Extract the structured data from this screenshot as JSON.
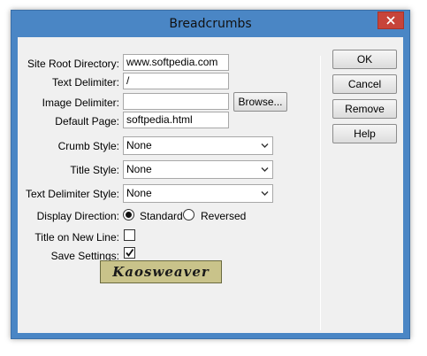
{
  "window": {
    "title": "Breadcrumbs"
  },
  "form": {
    "site_root_label": "Site Root Directory:",
    "site_root_value": "www.softpedia.com",
    "text_delim_label": "Text Delimiter:",
    "text_delim_value": "/",
    "image_delim_label": "Image Delimiter:",
    "image_delim_value": "",
    "browse_label": "Browse...",
    "default_page_label": "Default Page:",
    "default_page_value": "softpedia.html",
    "crumb_style_label": "Crumb Style:",
    "crumb_style_value": "None",
    "title_style_label": "Title Style:",
    "title_style_value": "None",
    "text_delim_style_label": "Text Delimiter Style:",
    "text_delim_style_value": "None",
    "display_direction_label": "Display Direction:",
    "direction_standard": "Standard",
    "direction_reversed": "Reversed",
    "title_new_line_label": "Title on New Line:",
    "save_settings_label": "Save Settings:"
  },
  "buttons": {
    "ok": "OK",
    "cancel": "Cancel",
    "remove": "Remove",
    "help": "Help"
  },
  "state": {
    "direction_selected": "Standard",
    "title_on_new_line": false,
    "save_settings": true
  },
  "logo": {
    "text": "Kaosweaver"
  },
  "colors": {
    "frame": "#4a86c5",
    "close": "#c7443a",
    "client": "#f0f0f0"
  }
}
